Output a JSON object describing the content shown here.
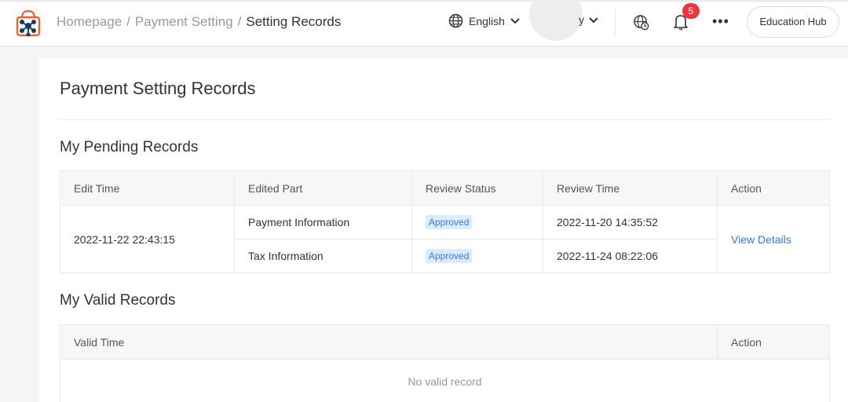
{
  "header": {
    "breadcrumb": [
      "Homepage",
      "Payment Setting",
      "Setting Records"
    ],
    "language": "English",
    "user_trail": "y",
    "notification_count": "5",
    "more_label": "•••",
    "account_button": "Education Hub"
  },
  "page": {
    "title": "Payment Setting Records"
  },
  "pending": {
    "section_title": "My Pending Records",
    "columns": [
      "Edit Time",
      "Edited Part",
      "Review Status",
      "Review Time",
      "Action"
    ],
    "edit_time": "2022-11-22 22:43:15",
    "rows": [
      {
        "part": "Payment Information",
        "status": "Approved",
        "review_time": "2022-11-20 14:35:52"
      },
      {
        "part": "Tax Information",
        "status": "Approved",
        "review_time": "2022-11-24 08:22:06"
      }
    ],
    "action": "View Details"
  },
  "valid": {
    "section_title": "My Valid Records",
    "columns": [
      "Valid Time",
      "Action"
    ],
    "empty_text": "No valid record"
  },
  "colors": {
    "accent": "#2f7bd6",
    "badge": "#e8383d",
    "status_bg": "#dbeafd"
  }
}
